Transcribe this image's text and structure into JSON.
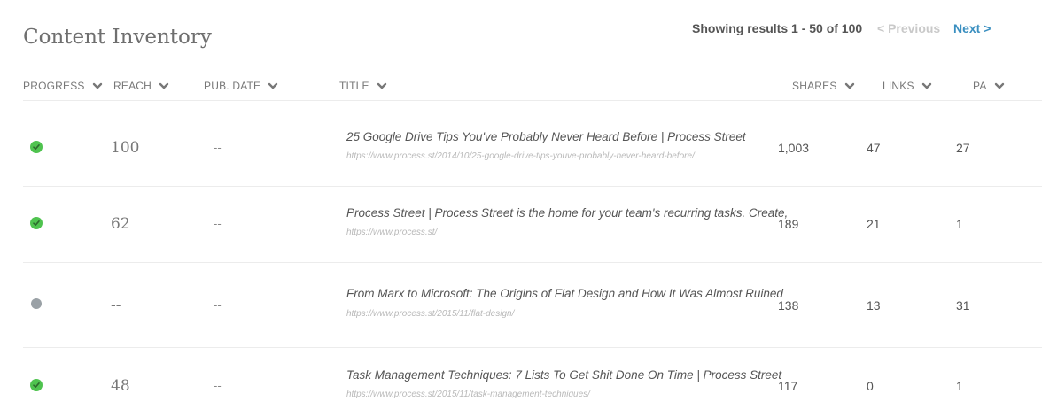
{
  "page_title": "Content Inventory",
  "pagination": {
    "results_text": "Showing results 1 - 50 of 100",
    "previous_label": "< Previous",
    "next_label": "Next >"
  },
  "columns": {
    "progress": "PROGRESS",
    "reach": "REACH",
    "pub_date": "PUB. DATE",
    "title": "TITLE",
    "shares": "SHARES",
    "links": "LINKS",
    "pa": "PA"
  },
  "colors": {
    "status_done": "#4fc34f",
    "status_pending": "#9aa1a6",
    "link_accent": "#3a8fc0",
    "disabled": "#c9c9c9"
  },
  "rows": [
    {
      "status": "done",
      "status_icon": "check-icon",
      "reach": "100",
      "pub_date": "--",
      "title": "25 Google Drive Tips You've Probably Never Heard Before | Process Street",
      "url": "https://www.process.st/2014/10/25-google-drive-tips-youve-probably-never-heard-before/",
      "shares": "1,003",
      "links": "47",
      "pa": "27"
    },
    {
      "status": "done",
      "status_icon": "check-icon",
      "reach": "62",
      "pub_date": "--",
      "title": "Process Street | Process Street is the home for your team's recurring tasks. Create,",
      "url": "https://www.process.st/",
      "shares": "189",
      "links": "21",
      "pa": "1"
    },
    {
      "status": "pending",
      "status_icon": "dot-icon",
      "reach": "--",
      "pub_date": "--",
      "title": "From Marx to Microsoft: The Origins of Flat Design and How It Was Almost Ruined",
      "url": "https://www.process.st/2015/11/flat-design/",
      "shares": "138",
      "links": "13",
      "pa": "31"
    },
    {
      "status": "done",
      "status_icon": "check-icon",
      "reach": "48",
      "pub_date": "--",
      "title": "Task Management Techniques: 7 Lists To Get Shit Done On Time | Process Street",
      "url": "https://www.process.st/2015/11/task-management-techniques/",
      "shares": "117",
      "links": "0",
      "pa": "1"
    }
  ]
}
